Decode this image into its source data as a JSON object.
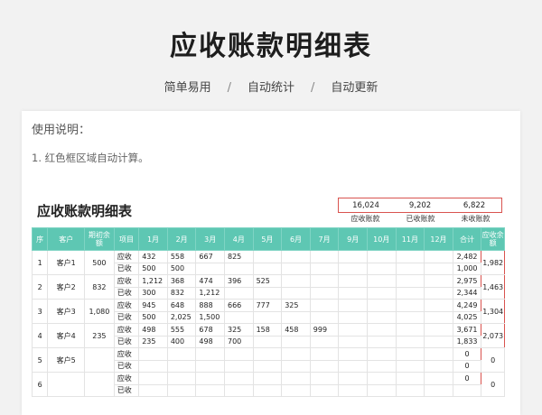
{
  "hero": {
    "title": "应收账款明细表",
    "features": [
      "简单易用",
      "自动统计",
      "自动更新"
    ],
    "separator": "/"
  },
  "usage": {
    "title": "使用说明：",
    "items": [
      "1. 红色框区域自动计算。"
    ]
  },
  "sheet": {
    "title": "应收账款明细表",
    "summary": {
      "values": [
        "16,024",
        "9,202",
        "6,822"
      ],
      "labels": [
        "应收账款",
        "已收账款",
        "未收账款"
      ]
    },
    "headers": [
      "序",
      "客户",
      "期初余额",
      "项目",
      "1月",
      "2月",
      "3月",
      "4月",
      "5月",
      "6月",
      "7月",
      "9月",
      "10月",
      "11月",
      "12月",
      "合计",
      "应收余额"
    ],
    "rows": [
      {
        "seq": "1",
        "customer": "客户1",
        "opening": "500",
        "receivable": [
          "432",
          "558",
          "667",
          "825",
          "",
          "",
          "",
          "",
          "",
          "",
          ""
        ],
        "received": [
          "500",
          "500",
          "",
          "",
          "",
          "",
          "",
          "",
          "",
          "",
          ""
        ],
        "total_receivable": "2,482",
        "total_received": "1,000",
        "balance": "1,982"
      },
      {
        "seq": "2",
        "customer": "客户2",
        "opening": "832",
        "receivable": [
          "1,212",
          "368",
          "474",
          "396",
          "525",
          "",
          "",
          "",
          "",
          "",
          ""
        ],
        "received": [
          "300",
          "832",
          "1,212",
          "",
          "",
          "",
          "",
          "",
          "",
          "",
          ""
        ],
        "total_receivable": "2,975",
        "total_received": "2,344",
        "balance": "1,463"
      },
      {
        "seq": "3",
        "customer": "客户3",
        "opening": "1,080",
        "receivable": [
          "945",
          "648",
          "888",
          "666",
          "777",
          "325",
          "",
          "",
          "",
          "",
          ""
        ],
        "received": [
          "500",
          "2,025",
          "1,500",
          "",
          "",
          "",
          "",
          "",
          "",
          "",
          ""
        ],
        "total_receivable": "4,249",
        "total_received": "4,025",
        "balance": "1,304"
      },
      {
        "seq": "4",
        "customer": "客户4",
        "opening": "235",
        "receivable": [
          "498",
          "555",
          "678",
          "325",
          "158",
          "458",
          "999",
          "",
          "",
          "",
          ""
        ],
        "received": [
          "235",
          "400",
          "498",
          "700",
          "",
          "",
          "",
          "",
          "",
          "",
          ""
        ],
        "total_receivable": "3,671",
        "total_received": "1,833",
        "balance": "2,073"
      },
      {
        "seq": "5",
        "customer": "客户5",
        "opening": "",
        "receivable": [
          "",
          "",
          "",
          "",
          "",
          "",
          "",
          "",
          "",
          "",
          ""
        ],
        "received": [
          "",
          "",
          "",
          "",
          "",
          "",
          "",
          "",
          "",
          "",
          ""
        ],
        "total_receivable": "0",
        "total_received": "0",
        "balance": "0"
      },
      {
        "seq": "6",
        "customer": "",
        "opening": "",
        "receivable": [
          "",
          "",
          "",
          "",
          "",
          "",
          "",
          "",
          "",
          "",
          ""
        ],
        "received": [
          "",
          "",
          "",
          "",
          "",
          "",
          "",
          "",
          "",
          "",
          ""
        ],
        "total_receivable": "0",
        "total_received": "",
        "balance": "0"
      }
    ],
    "item_labels": {
      "receivable": "应收",
      "received": "已收"
    }
  },
  "colors": {
    "header_bg": "#5ec7b3",
    "highlight_border": "#d9534f"
  }
}
